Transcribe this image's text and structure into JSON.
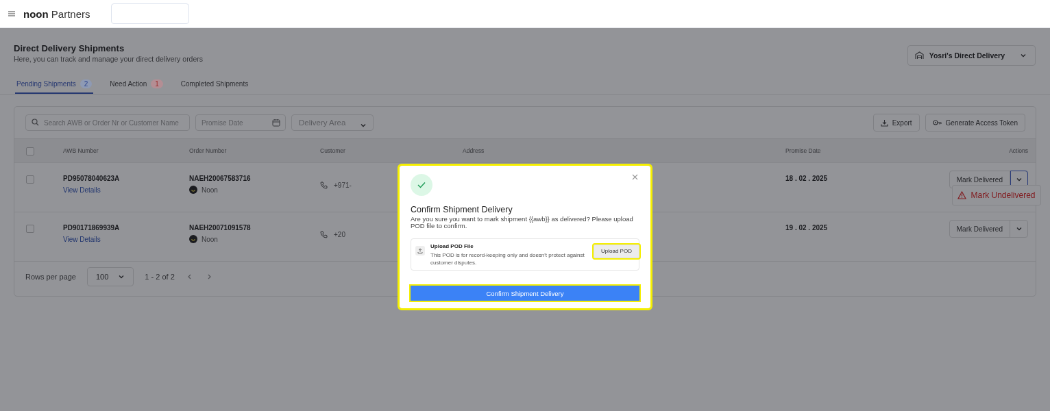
{
  "header": {
    "logo": "**noon** Partners"
  },
  "page": {
    "title": "Direct Delivery Shipments",
    "subtitle": "Here, you can track and manage your direct delivery orders",
    "store_selector": "Yosri's Direct Delivery"
  },
  "tabs": [
    {
      "label": "Pending Shipments",
      "count": "2",
      "selected": true,
      "color": "#8e9ab4"
    },
    {
      "label": "Need Action",
      "count": "1",
      "selected": false,
      "color": "#b48e94"
    },
    {
      "label": "Completed Shipments",
      "selected": false
    }
  ],
  "toolbar": {
    "search_placeholder": "Search AWB or Order Nr or Customer Name",
    "date_placeholder": "Promise Date",
    "area_placeholder": "Delivery Area",
    "export_button": "Export",
    "token_button": "Generate Access Token"
  },
  "table": {
    "select_all_checked": false,
    "columns": [
      "AWB Number",
      "Order Number",
      "Customer",
      "Address",
      "Promise Date",
      "Actions"
    ],
    "rows": [
      {
        "checked": false,
        "awb": "PD95078040623A",
        "link": "View Details",
        "order": "NAEH20067583716",
        "seller": "Noon",
        "phone": "+971-",
        "promise_date": "18 . 02 . 2025",
        "action": "Mark Delivered",
        "expanded": true
      },
      {
        "checked": false,
        "awb": "PD90171869939A",
        "link": "View Details",
        "order": "NAEH20071091578",
        "seller": "Noon",
        "phone": "+20",
        "promise_date": "19 . 02 . 2025",
        "action": "Mark Delivered",
        "expanded": false
      }
    ],
    "menu_item": "Mark Undelivered"
  },
  "pagination": {
    "rows_label": "Rows per page",
    "rows_value": "100",
    "range": "1 - 2 of 2"
  },
  "modal": {
    "highlighted": true,
    "title": "Confirm Shipment Delivery",
    "message": "Are you sure you want to mark shipment {{awb}} as delivered? Please upload POD file to confirm.",
    "upload_title": "Upload POD File",
    "upload_note": "This POD is for record-keeping only and doesn't protect against customer disputes.",
    "upload_button": {
      "label": "Upload POD",
      "highlighted": true
    },
    "confirm_button": {
      "label": "Confirm Shipment Delivery",
      "highlighted": true
    }
  }
}
